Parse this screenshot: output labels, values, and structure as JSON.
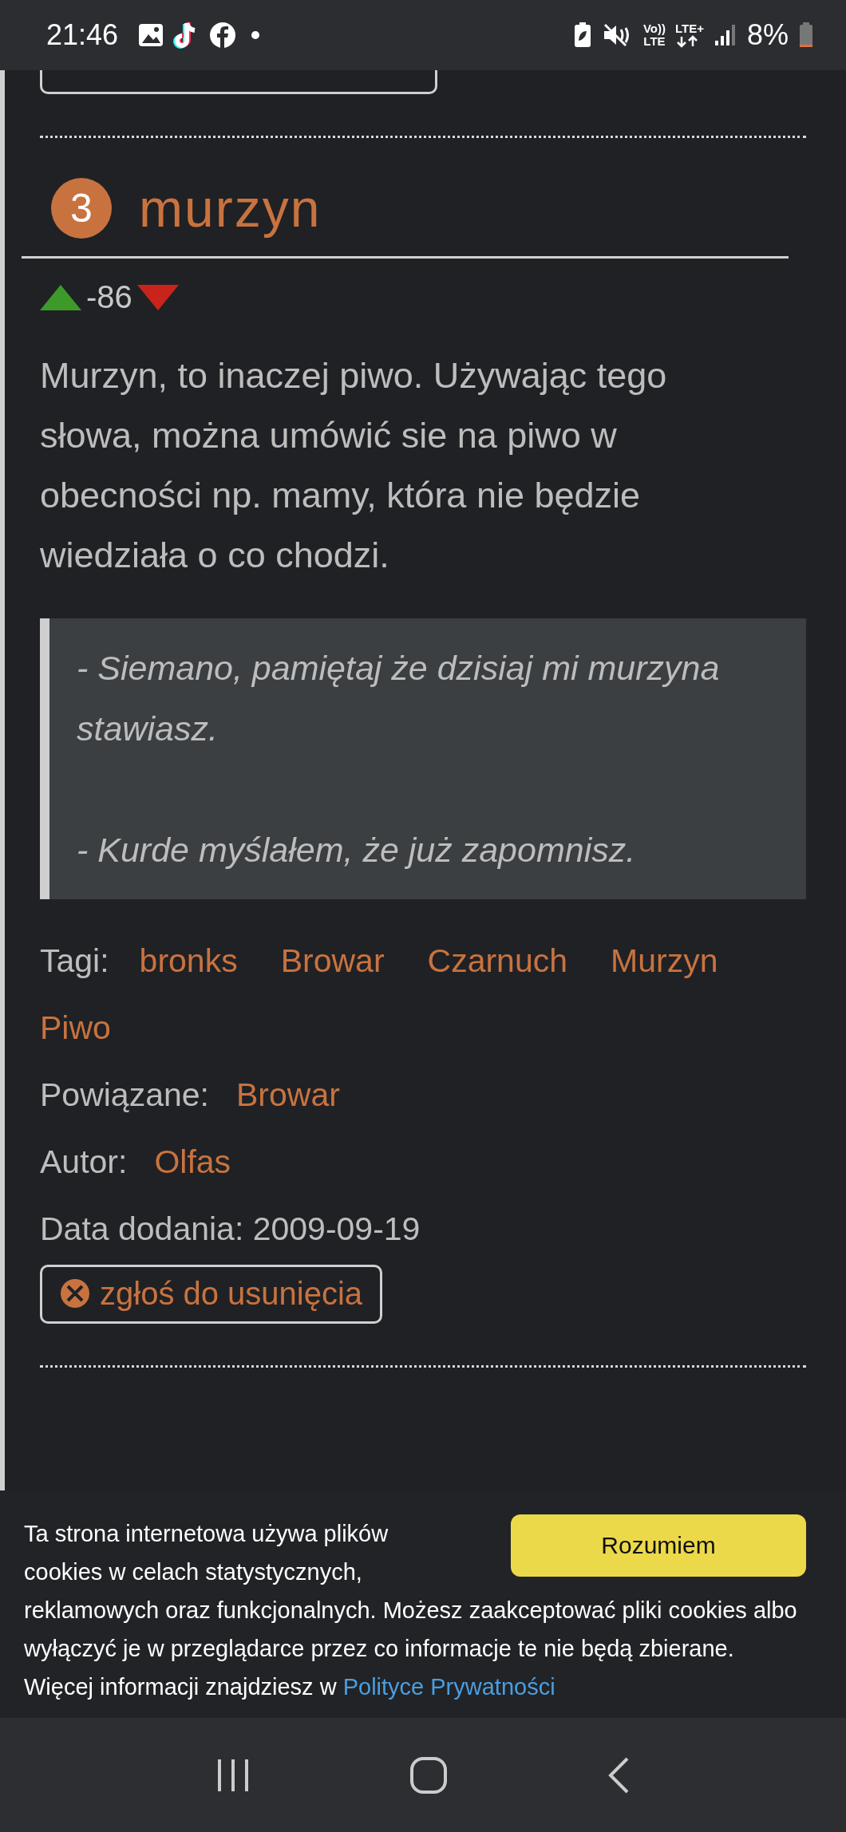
{
  "status_bar": {
    "time": "21:46",
    "volte_top": "Vo))",
    "volte_bottom": "LTE",
    "network": "LTE+",
    "battery": "8%"
  },
  "entry": {
    "number": "3",
    "title": "murzyn",
    "score": "-86",
    "definition": "Murzyn, to inaczej piwo. Używając tego słowa, można umówić sie na piwo w obecności np. mamy, która nie będzie wiedziała o co chodzi.",
    "example": [
      "- Siemano, pamiętaj że dzisiaj mi murzyna stawiasz.",
      "- Kurde myślałem, że już zapomnisz."
    ],
    "tags_label": "Tagi:",
    "tags": [
      "bronks",
      "Browar",
      "Czarnuch",
      "Murzyn",
      "Piwo"
    ],
    "related_label": "Powiązane:",
    "related": [
      "Browar"
    ],
    "author_label": "Autor:",
    "author": "Olfas",
    "date": "Data dodania: 2009-09-19",
    "report_button": "zgłoś do usunięcia"
  },
  "cookie_banner": {
    "text_intro": "Ta strona internetowa używa plików cookies w celach statystycznych,",
    "text": "reklamowych oraz funkcjonalnych. Możesz zaakceptować pliki cookies albo wyłączyć je w przeglądarce przez co informacje te nie będą zbierane. Więcej informacji znajdziesz w ",
    "link": "Polityce Prywatności",
    "button": "Rozumiem"
  }
}
